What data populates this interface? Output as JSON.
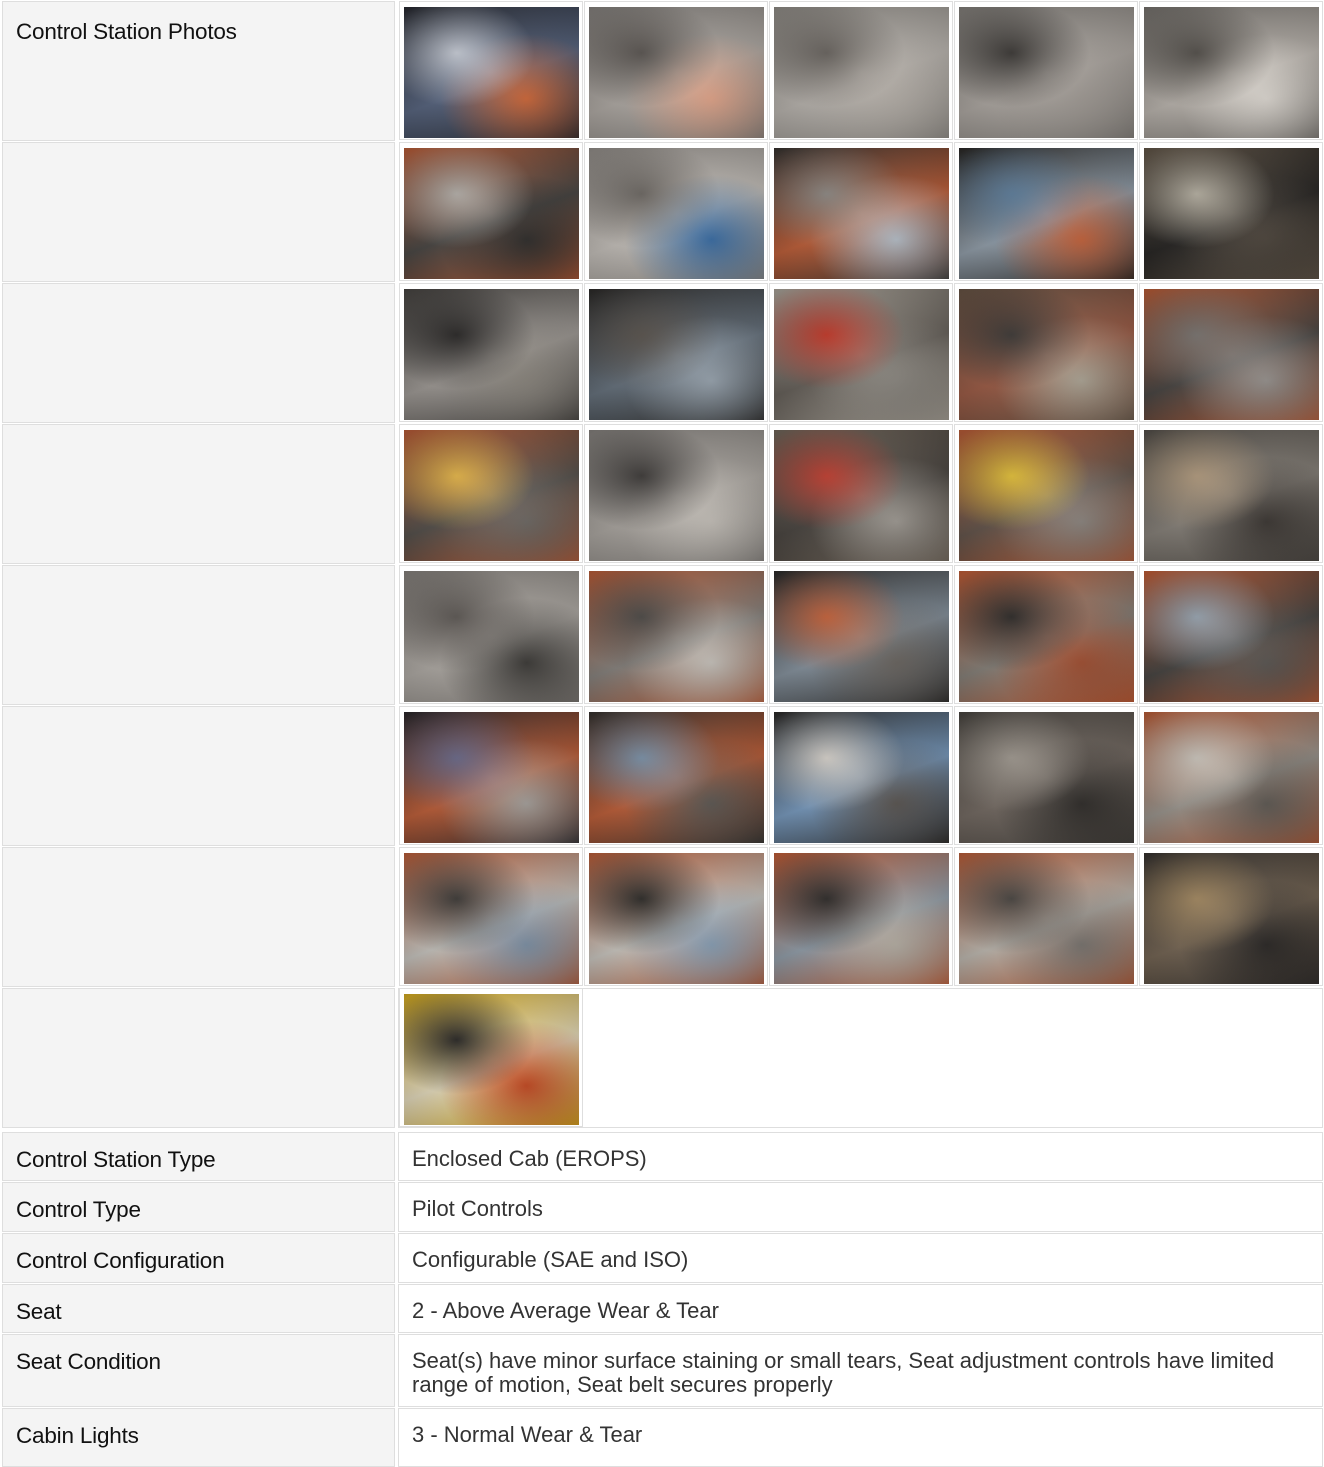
{
  "section_title": "Control Station Photos",
  "photo_rows": [
    {
      "photos": [
        {
          "icon": "display-monitor-photo",
          "colors": [
            "#2a2c33",
            "#5c6a86",
            "#c9ced8",
            "#d46a3a"
          ]
        },
        {
          "icon": "panel-socket-photo",
          "colors": [
            "#8e8a86",
            "#b9b3ad",
            "#5b5652",
            "#e7a88c"
          ]
        },
        {
          "icon": "panel-switches-photo",
          "colors": [
            "#9a9690",
            "#c2bdb7",
            "#6a6560",
            "#b8b2ab"
          ]
        },
        {
          "icon": "panel-vent-photo",
          "colors": [
            "#8b8782",
            "#b6b0aa",
            "#3c3936",
            "#a49e98"
          ]
        },
        {
          "icon": "cupholder-photo",
          "colors": [
            "#7d7974",
            "#c5bfb8",
            "#54504b",
            "#e2ddd6"
          ]
        }
      ]
    },
    {
      "photos": [
        {
          "icon": "cab-rear-window-photo",
          "colors": [
            "#c8643c",
            "#4e4b48",
            "#b6b1ab",
            "#2f2d2b"
          ]
        },
        {
          "icon": "cab-ceiling-photo",
          "colors": [
            "#9d9893",
            "#cfcac4",
            "#6e6964",
            "#3a6fa8"
          ]
        },
        {
          "icon": "cab-front-window-photo",
          "colors": [
            "#3a3734",
            "#c8643c",
            "#8f8a85",
            "#b9c2cc"
          ]
        },
        {
          "icon": "cab-door-photo",
          "colors": [
            "#2c2a28",
            "#9aa7b3",
            "#5f7f9d",
            "#c8643c"
          ]
        },
        {
          "icon": "seat-armrest-photo",
          "colors": [
            "#6a5d4e",
            "#2a2826",
            "#b8b2a4",
            "#4e463d"
          ]
        }
      ]
    },
    {
      "photos": [
        {
          "icon": "switch-panel-photo",
          "colors": [
            "#4b4845",
            "#a8a39e",
            "#2a2827",
            "#8c877f"
          ]
        },
        {
          "icon": "joystick-photo",
          "colors": [
            "#2f2d2b",
            "#6c7884",
            "#5a544e",
            "#9ba7b2"
          ]
        },
        {
          "icon": "joystick-pedal-photo",
          "colors": [
            "#b8b1a6",
            "#6d6760",
            "#c63a2a",
            "#8e8a83"
          ]
        },
        {
          "icon": "joystick-console-photo",
          "colors": [
            "#6e5a4a",
            "#a5614a",
            "#3e3a37",
            "#b0a898"
          ]
        },
        {
          "icon": "joystick-right-photo",
          "colors": [
            "#c8643c",
            "#4e4a47",
            "#7a7571",
            "#9a9591"
          ]
        }
      ]
    },
    {
      "photos": [
        {
          "icon": "warning-labels-photo",
          "colors": [
            "#c8643c",
            "#5a5550",
            "#e8b84a",
            "#6f6a65"
          ]
        },
        {
          "icon": "dash-switches-photo",
          "colors": [
            "#8e8a86",
            "#b4afa9",
            "#3e3b39",
            "#c8c3bc"
          ]
        },
        {
          "icon": "control-console-photo",
          "colors": [
            "#7a6e61",
            "#4f4a45",
            "#c44032",
            "#a29d96"
          ]
        },
        {
          "icon": "lever-console-photo",
          "colors": [
            "#c8643c",
            "#6a5a50",
            "#e6c33a",
            "#8e8781"
          ]
        },
        {
          "icon": "cupholder-floor-photo",
          "colors": [
            "#5a554f",
            "#8e8880",
            "#b39c7f",
            "#3c3733"
          ]
        }
      ]
    },
    {
      "photos": [
        {
          "icon": "interior-knob-photo",
          "colors": [
            "#8f8a85",
            "#b8b3ad",
            "#5e5955",
            "#3c3a37"
          ]
        },
        {
          "icon": "door-latch-photo",
          "colors": [
            "#c8643c",
            "#8f8a85",
            "#4e4b48",
            "#cbc6bf"
          ]
        },
        {
          "icon": "air-vent-photo",
          "colors": [
            "#2f2d2b",
            "#8d9aa6",
            "#c8643c",
            "#6b6661"
          ]
        },
        {
          "icon": "boom-exterior-photo",
          "colors": [
            "#d0643a",
            "#8e8880",
            "#2f2c2a",
            "#a45032"
          ]
        },
        {
          "icon": "vent-exterior-photo",
          "colors": [
            "#d0643a",
            "#4c4946",
            "#9aa7b3",
            "#5b5753"
          ]
        }
      ]
    },
    {
      "photos": [
        {
          "icon": "gauge-monitor-photo",
          "colors": [
            "#2c2a2f",
            "#c8643c",
            "#6b6a8a",
            "#a8a39e"
          ]
        },
        {
          "icon": "cab-window-view-photo",
          "colors": [
            "#3a3734",
            "#c8643c",
            "#7c93aa",
            "#5e5954"
          ]
        },
        {
          "icon": "cab-skylight-photo",
          "colors": [
            "#2e2c2a",
            "#7fa3c9",
            "#d9d4cd",
            "#5b5652"
          ]
        },
        {
          "icon": "floor-pedals-photo",
          "colors": [
            "#4e4a45",
            "#7a7068",
            "#a19a91",
            "#2f2c29"
          ]
        },
        {
          "icon": "seat-base-photo",
          "colors": [
            "#c8643c",
            "#a39d95",
            "#cdc7be",
            "#5f5a54"
          ]
        }
      ]
    },
    {
      "photos": [
        {
          "icon": "operator-seat-photo",
          "colors": [
            "#c8643c",
            "#d3d0ca",
            "#3e3b38",
            "#7f93a8"
          ]
        },
        {
          "icon": "cab-interior-seat-photo",
          "colors": [
            "#c8643c",
            "#d6d2cb",
            "#2e2c29",
            "#8ba2b8"
          ]
        },
        {
          "icon": "cab-outside-photo",
          "colors": [
            "#d0643a",
            "#9aa7b3",
            "#2f2c2a",
            "#b8b1a6"
          ]
        },
        {
          "icon": "seat-side-photo",
          "colors": [
            "#c8643c",
            "#c9c3ba",
            "#4a4642",
            "#7a7570"
          ]
        },
        {
          "icon": "engine-compartment-photo",
          "colors": [
            "#3a3633",
            "#7a6a58",
            "#a58a62",
            "#2a2725"
          ]
        }
      ]
    },
    {
      "photos": [
        {
          "icon": "caution-label-photo",
          "colors": [
            "#e6b820",
            "#f2e8c8",
            "#2a2826",
            "#c84a22"
          ]
        }
      ]
    }
  ],
  "details": [
    {
      "label": "Control Station Type",
      "value": "Enclosed Cab (EROPS)"
    },
    {
      "label": "Control Type",
      "value": "Pilot Controls"
    },
    {
      "label": "Control Configuration",
      "value": "Configurable (SAE and ISO)"
    },
    {
      "label": "Seat",
      "value": "2 - Above Average Wear & Tear"
    },
    {
      "label": "Seat Condition",
      "value": "Seat(s) have minor surface staining or small tears, Seat adjustment controls have limited range of motion, Seat belt secures properly"
    },
    {
      "label": "Cabin Lights",
      "value": "3 - Normal Wear & Tear"
    }
  ]
}
